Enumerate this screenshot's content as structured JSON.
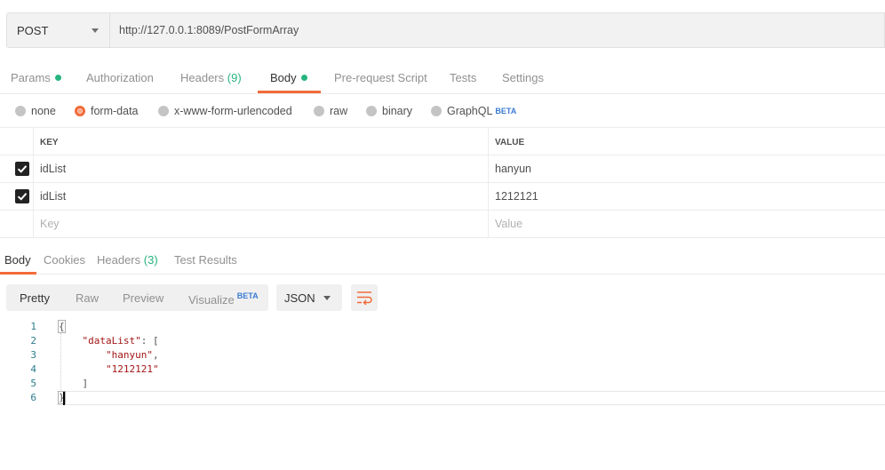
{
  "request": {
    "method": "POST",
    "url": "http://127.0.0.1:8089/PostFormArray"
  },
  "request_tabs": [
    {
      "label": "Params",
      "dot": true
    },
    {
      "label": "Authorization"
    },
    {
      "label": "Headers",
      "count": "(9)"
    },
    {
      "label": "Body",
      "dot": true,
      "active": true
    },
    {
      "label": "Pre-request Script"
    },
    {
      "label": "Tests"
    },
    {
      "label": "Settings"
    }
  ],
  "body_types": [
    {
      "label": "none"
    },
    {
      "label": "form-data",
      "checked": true
    },
    {
      "label": "x-www-form-urlencoded"
    },
    {
      "label": "raw"
    },
    {
      "label": "binary"
    },
    {
      "label": "GraphQL",
      "badge": "BETA"
    }
  ],
  "params_table": {
    "headers": {
      "key": "KEY",
      "value": "VALUE"
    },
    "rows": [
      {
        "key": "idList",
        "value": "hanyun",
        "checked": true
      },
      {
        "key": "idList",
        "value": "1212121",
        "checked": true
      }
    ],
    "placeholder": {
      "key": "Key",
      "value": "Value"
    }
  },
  "response_tabs": [
    {
      "label": "Body",
      "active": true
    },
    {
      "label": "Cookies"
    },
    {
      "label": "Headers",
      "count": "(3)"
    },
    {
      "label": "Test Results"
    }
  ],
  "view_modes": [
    {
      "label": "Pretty",
      "active": true
    },
    {
      "label": "Raw"
    },
    {
      "label": "Preview"
    },
    {
      "label": "Visualize",
      "badge": "BETA"
    }
  ],
  "format": "JSON",
  "icons": {
    "wrap": "wrap-lines-icon",
    "dropdown": "chevron-down-icon",
    "check": "check-icon",
    "dot": "status-dot-icon"
  },
  "colors": {
    "accent": "#f26b3a",
    "green": "#26b47f",
    "beta": "#3a7bd5"
  },
  "code_lines": [
    {
      "n": "1",
      "text": "{"
    },
    {
      "n": "2",
      "text": "    \"dataList\": ["
    },
    {
      "n": "3",
      "text": "        \"hanyun\","
    },
    {
      "n": "4",
      "text": "        \"1212121\""
    },
    {
      "n": "5",
      "text": "    ]"
    },
    {
      "n": "6",
      "text": "}"
    }
  ]
}
